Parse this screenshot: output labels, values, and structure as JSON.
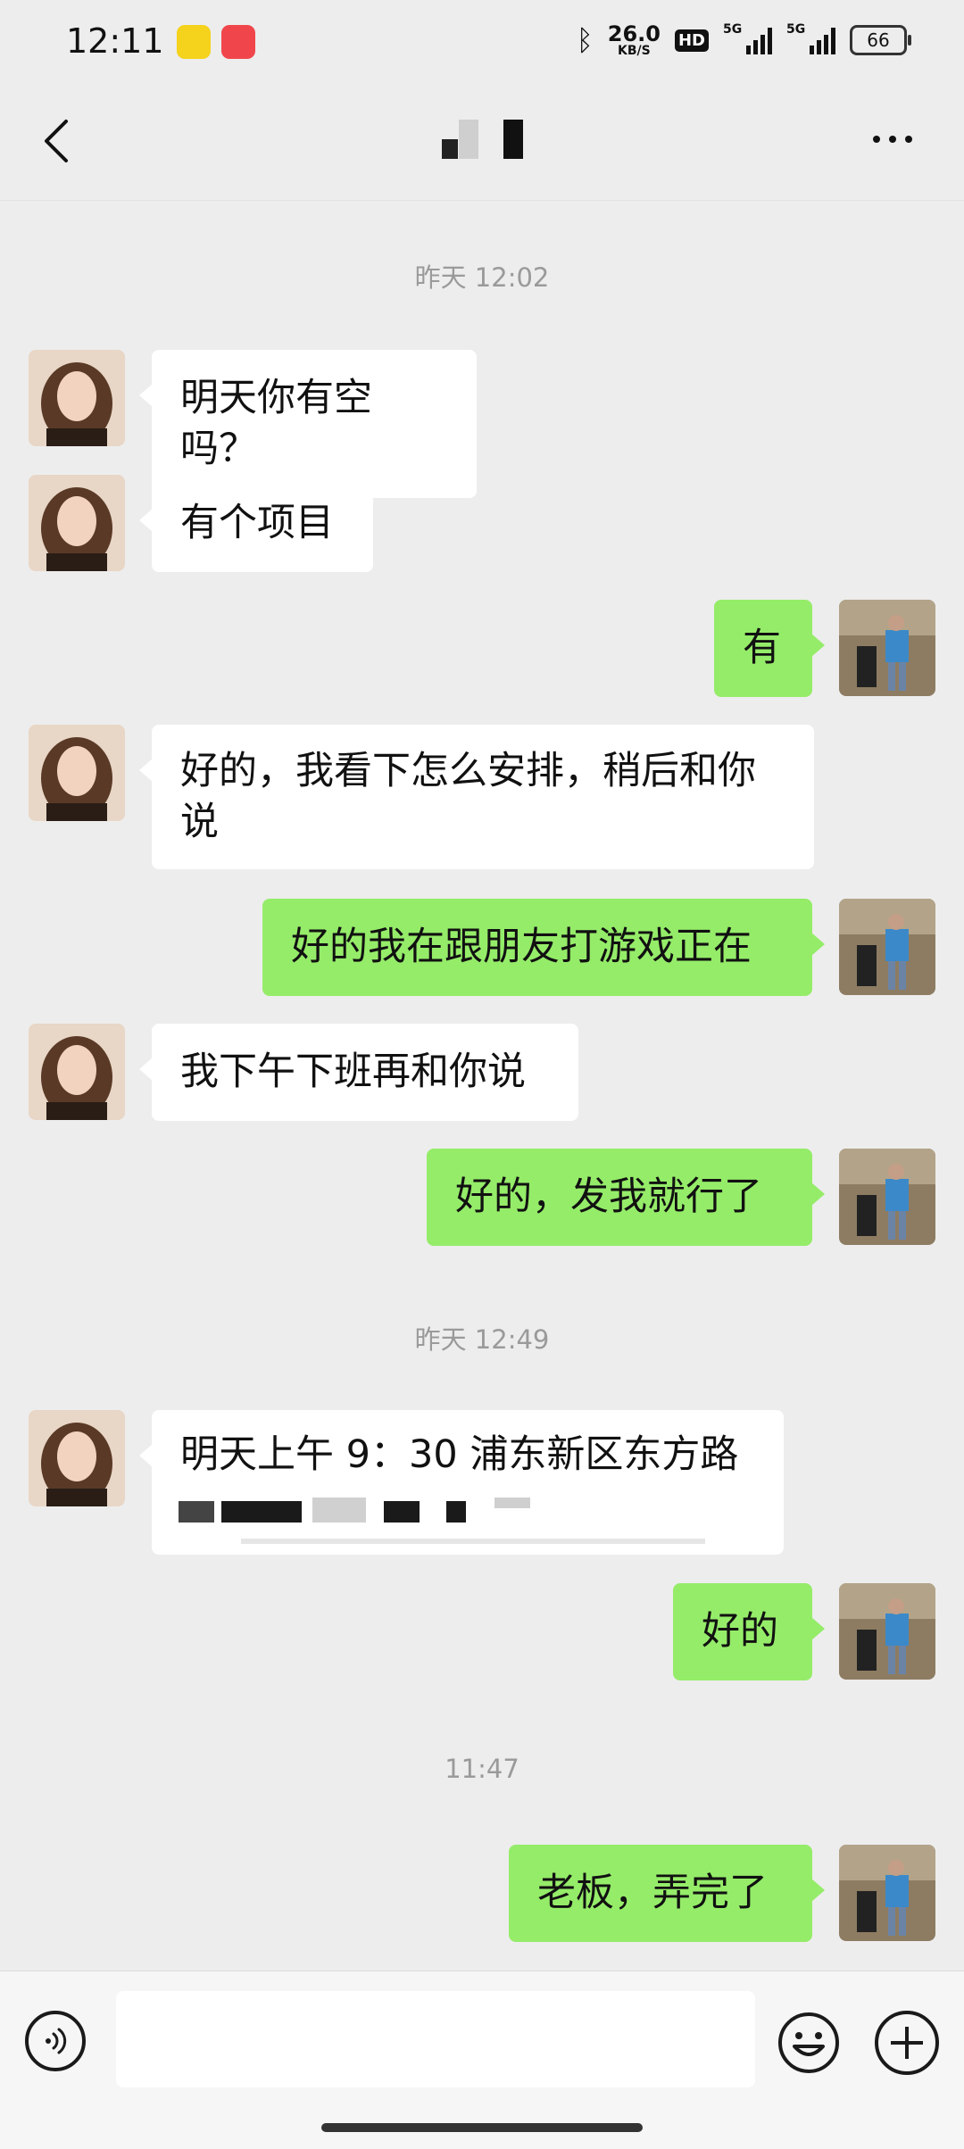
{
  "status_bar": {
    "time": "12:11",
    "net_speed_value": "26.0",
    "net_speed_unit": "KB/S",
    "hd_label": "HD",
    "signal1_label": "5G",
    "signal2_label": "5G",
    "battery_level": "66",
    "icons": [
      "app-icon-yellow",
      "app-icon-red",
      "bluetooth-icon",
      "signal-icon",
      "battery-icon"
    ]
  },
  "header": {
    "icons": [
      "back-icon",
      "more-icon"
    ]
  },
  "messages": [
    {
      "type": "time",
      "text": "昨天 12:02"
    },
    {
      "type": "in",
      "text": "明天你有空吗？"
    },
    {
      "type": "in",
      "text": "有个项目"
    },
    {
      "type": "out",
      "text": "有"
    },
    {
      "type": "in",
      "text": "好的，我看下怎么安排，稍后和你说"
    },
    {
      "type": "out",
      "text": "好的我在跟朋友打游戏正在"
    },
    {
      "type": "in",
      "text": "我下午下班再和你说"
    },
    {
      "type": "out",
      "text": "好的，发我就行了"
    },
    {
      "type": "time",
      "text": "昨天 12:49"
    },
    {
      "type": "in",
      "text": "明天上午 9：30 浦东新区东方路"
    },
    {
      "type": "out",
      "text": "好的"
    },
    {
      "type": "time",
      "text": "11:47"
    },
    {
      "type": "out",
      "text": "老板，弄完了"
    }
  ],
  "input_bar": {
    "placeholder": "",
    "icons": [
      "voice-icon",
      "emoji-icon",
      "plus-icon"
    ]
  },
  "colors": {
    "background": "#ededed",
    "outgoing_bubble": "#95ec69",
    "incoming_bubble": "#ffffff"
  }
}
